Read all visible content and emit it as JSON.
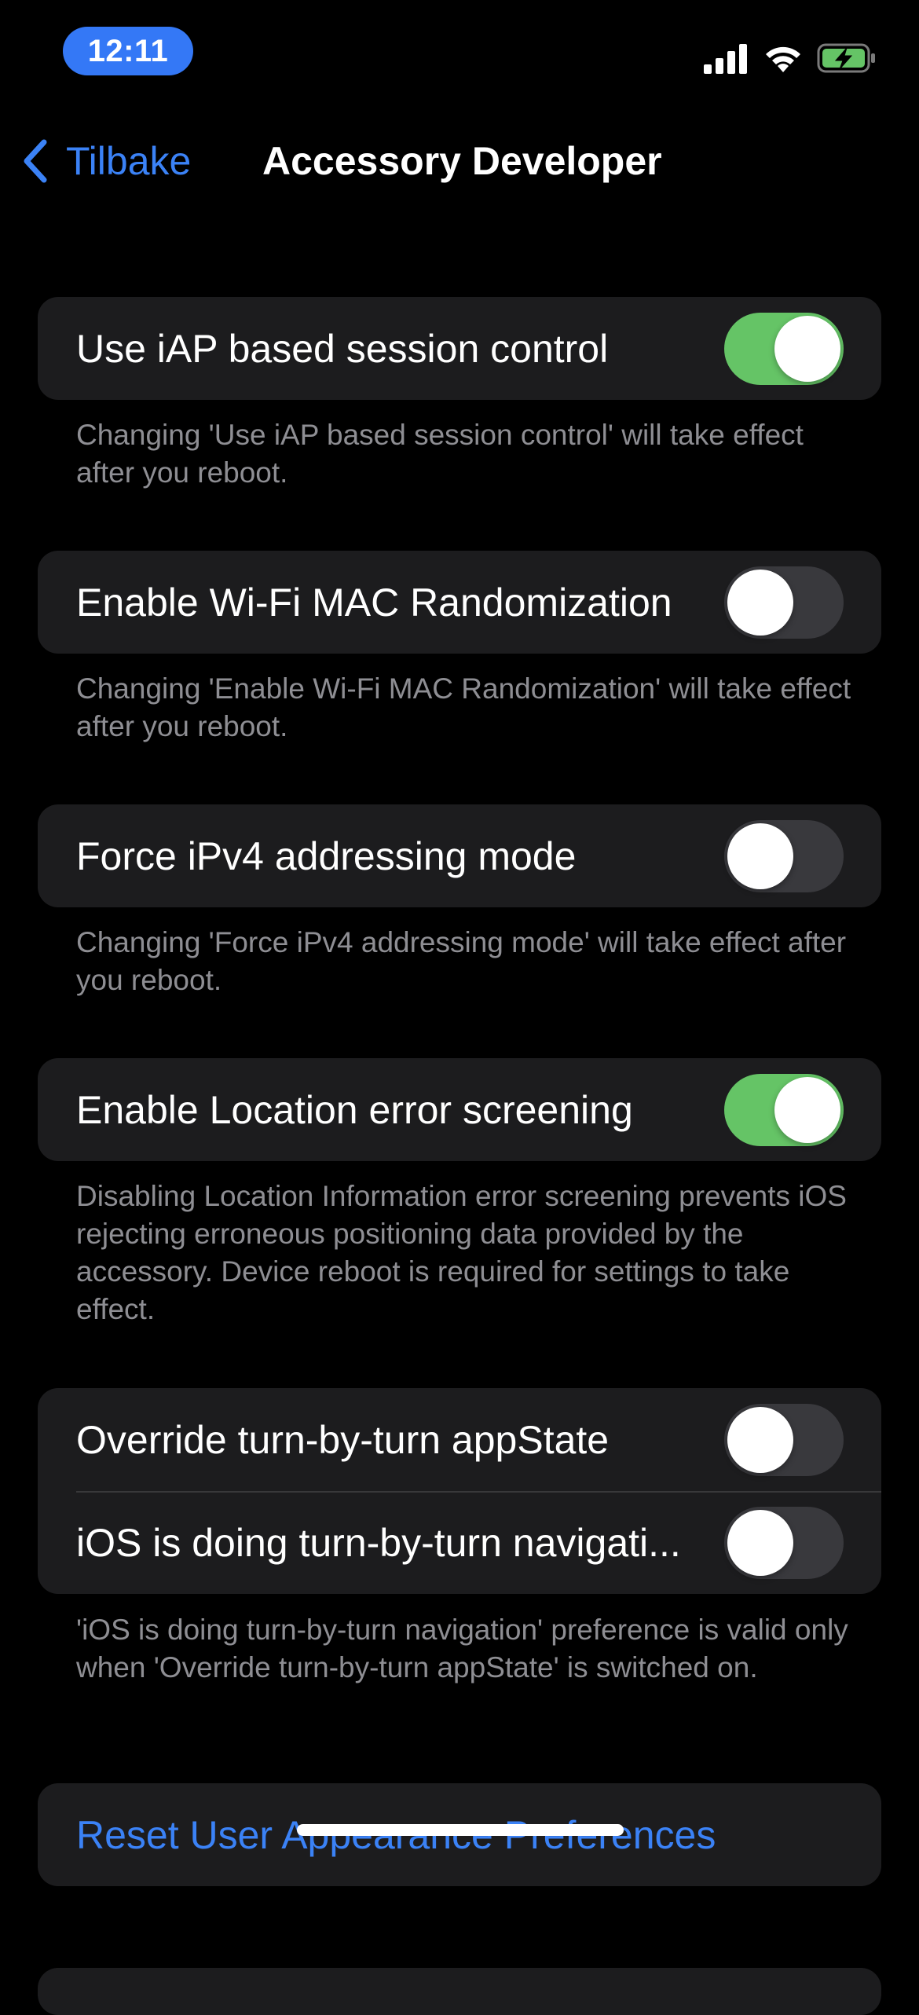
{
  "status_bar": {
    "time": "12:11",
    "time_pill_color": "#3478f6",
    "icons": [
      "cellular-signal-icon",
      "wifi-icon",
      "battery-charging-icon"
    ]
  },
  "nav": {
    "back_label": "Tilbake",
    "title": "Accessory Developer"
  },
  "colors": {
    "accent": "#3b82f6",
    "toggle_on": "#65c466",
    "toggle_off": "#39393d",
    "group_bg": "#1c1c1e",
    "footnote": "#8e8e93"
  },
  "settings": {
    "iap": {
      "label": "Use iAP based session control",
      "on": true,
      "footnote": "Changing 'Use iAP based session control' will take effect after you reboot."
    },
    "wifi_mac": {
      "label": "Enable Wi-Fi MAC Randomization",
      "on": false,
      "footnote": "Changing 'Enable Wi-Fi MAC Randomization' will take effect after you reboot."
    },
    "ipv4": {
      "label": "Force iPv4 addressing mode",
      "on": false,
      "footnote": "Changing 'Force iPv4 addressing mode' will take effect after you reboot."
    },
    "location": {
      "label": "Enable Location error screening",
      "on": true,
      "footnote": "Disabling Location Information error screening prevents iOS rejecting erroneous positioning data provided by the accessory. Device reboot is required for settings to take effect."
    },
    "turn_by_turn": {
      "override_label": "Override turn-by-turn appState",
      "override_on": false,
      "ios_nav_label": "iOS is doing turn-by-turn navigati...",
      "ios_nav_on": false,
      "footnote": "'iOS is doing turn-by-turn navigation' preference is valid only when 'Override turn-by-turn appState' is switched on."
    }
  },
  "reset": {
    "label": "Reset User Appearance Preferences"
  }
}
